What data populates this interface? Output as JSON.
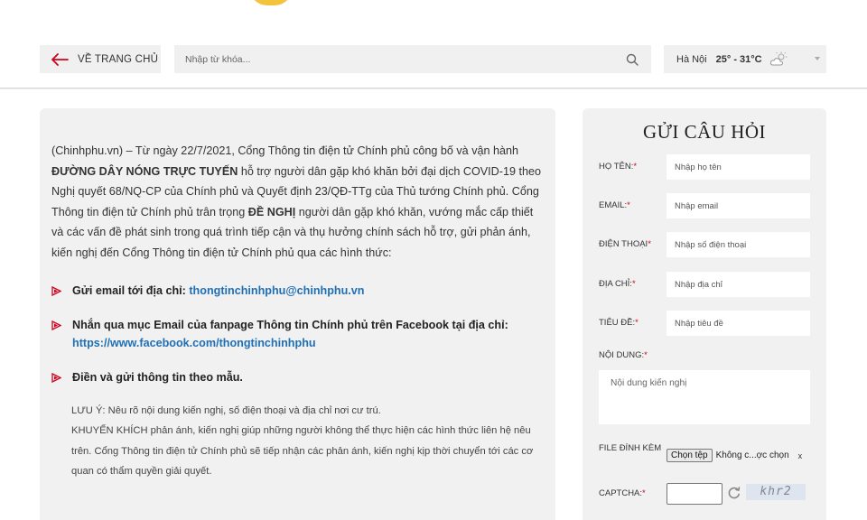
{
  "header": {
    "home_label": "VỀ TRANG CHỦ",
    "search_placeholder": "Nhập từ khóa...",
    "weather": {
      "city": "Hà Nội",
      "temp": "25° - 31°C",
      "icon": "cloud-sun-icon"
    }
  },
  "content": {
    "intro_prefix": "(Chinhphu.vn) – Từ ngày 22/7/2021, Cổng Thông tin điện tử Chính phủ công bố và vận hành ",
    "intro_bold1": "ĐƯỜNG DÂY NÓNG TRỰC TUYẾN",
    "intro_mid": " hỗ trợ người dân gặp khó khăn bởi đại dịch COVID-19 theo Nghị quyết 68/NQ-CP của Chính phủ và Quyết định 23/QĐ-TTg của Thủ tướng Chính phủ. Cổng Thông tin điện tử Chính phủ trân trọng ",
    "intro_bold2": "ĐỀ NGHỊ",
    "intro_suffix": " người dân gặp khó khăn, vướng mắc cấp thiết và các vấn đề phát sinh trong quá trình tiếp cận và thụ hưởng chính sách hỗ trợ, gửi phản ánh, kiến nghị đến Cổng Thông tin điện tử Chính phủ qua các hình thức:",
    "bullets": [
      {
        "text": "Gửi email tới địa chỉ: ",
        "link": "thongtinchinhphu@chinhphu.vn"
      },
      {
        "text": "Nhắn qua mục Email của fanpage Thông tin Chính phủ trên Facebook tại địa chỉ: ",
        "link": "https://www.facebook.com/thongtinchinhphu"
      },
      {
        "text": "Điền và gửi thông tin theo mẫu.",
        "link": ""
      }
    ],
    "note1": "LƯU Ý: Nêu rõ nội dung kiến nghị, số điện thoại và địa chỉ nơi cư trú.",
    "note2": "KHUYẾN KHÍCH phản ánh, kiến nghị giúp những người không thể thực hiện các hình thức liên hệ nêu trên. Cổng Thông tin điện tử Chính phủ sẽ tiếp nhận các phản ánh, kiến nghị kịp thời chuyển tới các cơ quan có thẩm quyền giải quyết."
  },
  "form": {
    "title": "GỬI CÂU HỎI",
    "fields": [
      {
        "label": "HỌ TÊN:",
        "placeholder": "Nhập họ tên"
      },
      {
        "label": "EMAIL:",
        "placeholder": "Nhập email"
      },
      {
        "label": "ĐIỆN THOẠI",
        "placeholder": "Nhập số điện thoại"
      },
      {
        "label": "ĐỊA CHỈ:",
        "placeholder": "Nhập địa chỉ"
      },
      {
        "label": "TIÊU ĐỀ:",
        "placeholder": "Nhập tiêu đề"
      }
    ],
    "required_mark": "*",
    "content_label": "NỘI DUNG:",
    "content_placeholder": "Nội dung kiến nghị",
    "file_label": "FILE ĐÍNH KÈM",
    "file_button": "Chọn tệp",
    "file_name": "Không c...ợc chọn",
    "file_clear": "x",
    "captcha_label": "CAPTCHA:",
    "captcha_text": "khr2"
  },
  "colors": {
    "accent_red": "#d0021b",
    "link": "#1f6fb5",
    "panel": "#f1f1f1"
  }
}
